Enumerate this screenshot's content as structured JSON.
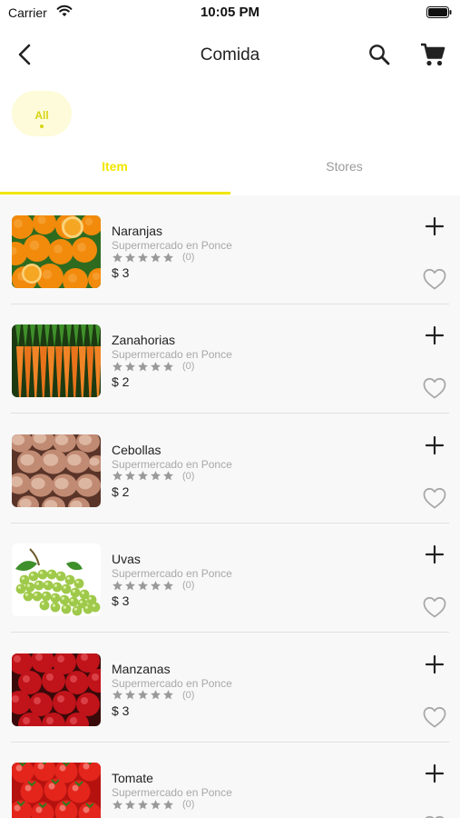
{
  "status_bar": {
    "carrier": "Carrier",
    "time": "10:05 PM"
  },
  "nav": {
    "title": "Comida",
    "back_icon": "chevron-left-icon",
    "search_icon": "search-icon",
    "cart_icon": "shopping-cart-icon"
  },
  "filter_chip": {
    "label": "All",
    "selected": true
  },
  "tabs": [
    {
      "label": "Item",
      "selected": true
    },
    {
      "label": "Stores",
      "selected": false
    }
  ],
  "colors": {
    "accent": "#f1e600",
    "chip_background": "#fdfbd9",
    "list_background": "#f8f8f8",
    "muted_text": "#a8a8a8"
  },
  "products": [
    {
      "name": "Naranjas",
      "store": "Supermercado en Ponce",
      "rating": 0,
      "reviews": "(0)",
      "price": "$ 3",
      "image": "oranges"
    },
    {
      "name": "Zanahorias",
      "store": "Supermercado en Ponce",
      "rating": 0,
      "reviews": "(0)",
      "price": "$ 2",
      "image": "carrots"
    },
    {
      "name": "Cebollas",
      "store": "Supermercado en Ponce",
      "rating": 0,
      "reviews": "(0)",
      "price": "$ 2",
      "image": "onions"
    },
    {
      "name": "Uvas",
      "store": "Supermercado en Ponce",
      "rating": 0,
      "reviews": "(0)",
      "price": "$ 3",
      "image": "grapes"
    },
    {
      "name": "Manzanas",
      "store": "Supermercado en Ponce",
      "rating": 0,
      "reviews": "(0)",
      "price": "$ 3",
      "image": "apples"
    },
    {
      "name": "Tomate",
      "store": "Supermercado en Ponce",
      "rating": 0,
      "reviews": "(0)",
      "price": "",
      "image": "tomatoes"
    }
  ]
}
